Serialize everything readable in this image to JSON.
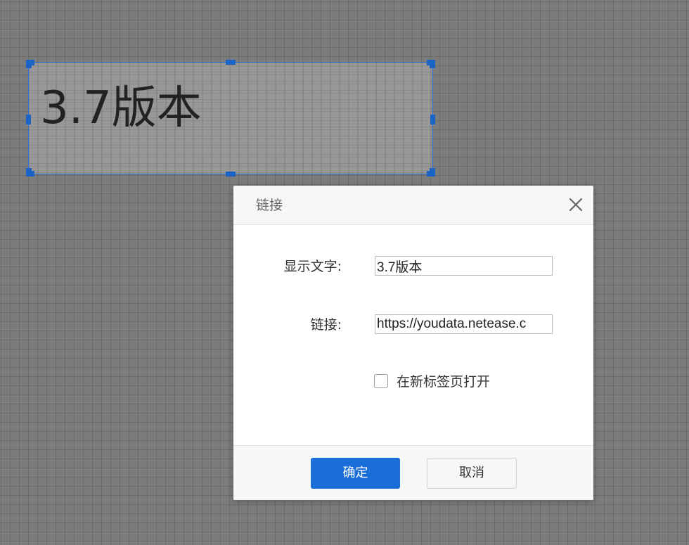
{
  "canvas": {
    "text_box": {
      "text": "3.7版本"
    }
  },
  "dialog": {
    "title": "链接",
    "close_icon": "close-icon",
    "fields": {
      "display_text": {
        "label": "显示文字:",
        "value": "3.7版本"
      },
      "link": {
        "label": "链接:",
        "value": "https://youdata.netease.c"
      }
    },
    "open_in_new_tab": {
      "label": "在新标签页打开",
      "checked": false
    },
    "buttons": {
      "ok": "确定",
      "cancel": "取消"
    }
  },
  "colors": {
    "primary": "#1a6ed8",
    "selection": "#2a6fd6",
    "canvas_bg": "#7c7c7c"
  }
}
